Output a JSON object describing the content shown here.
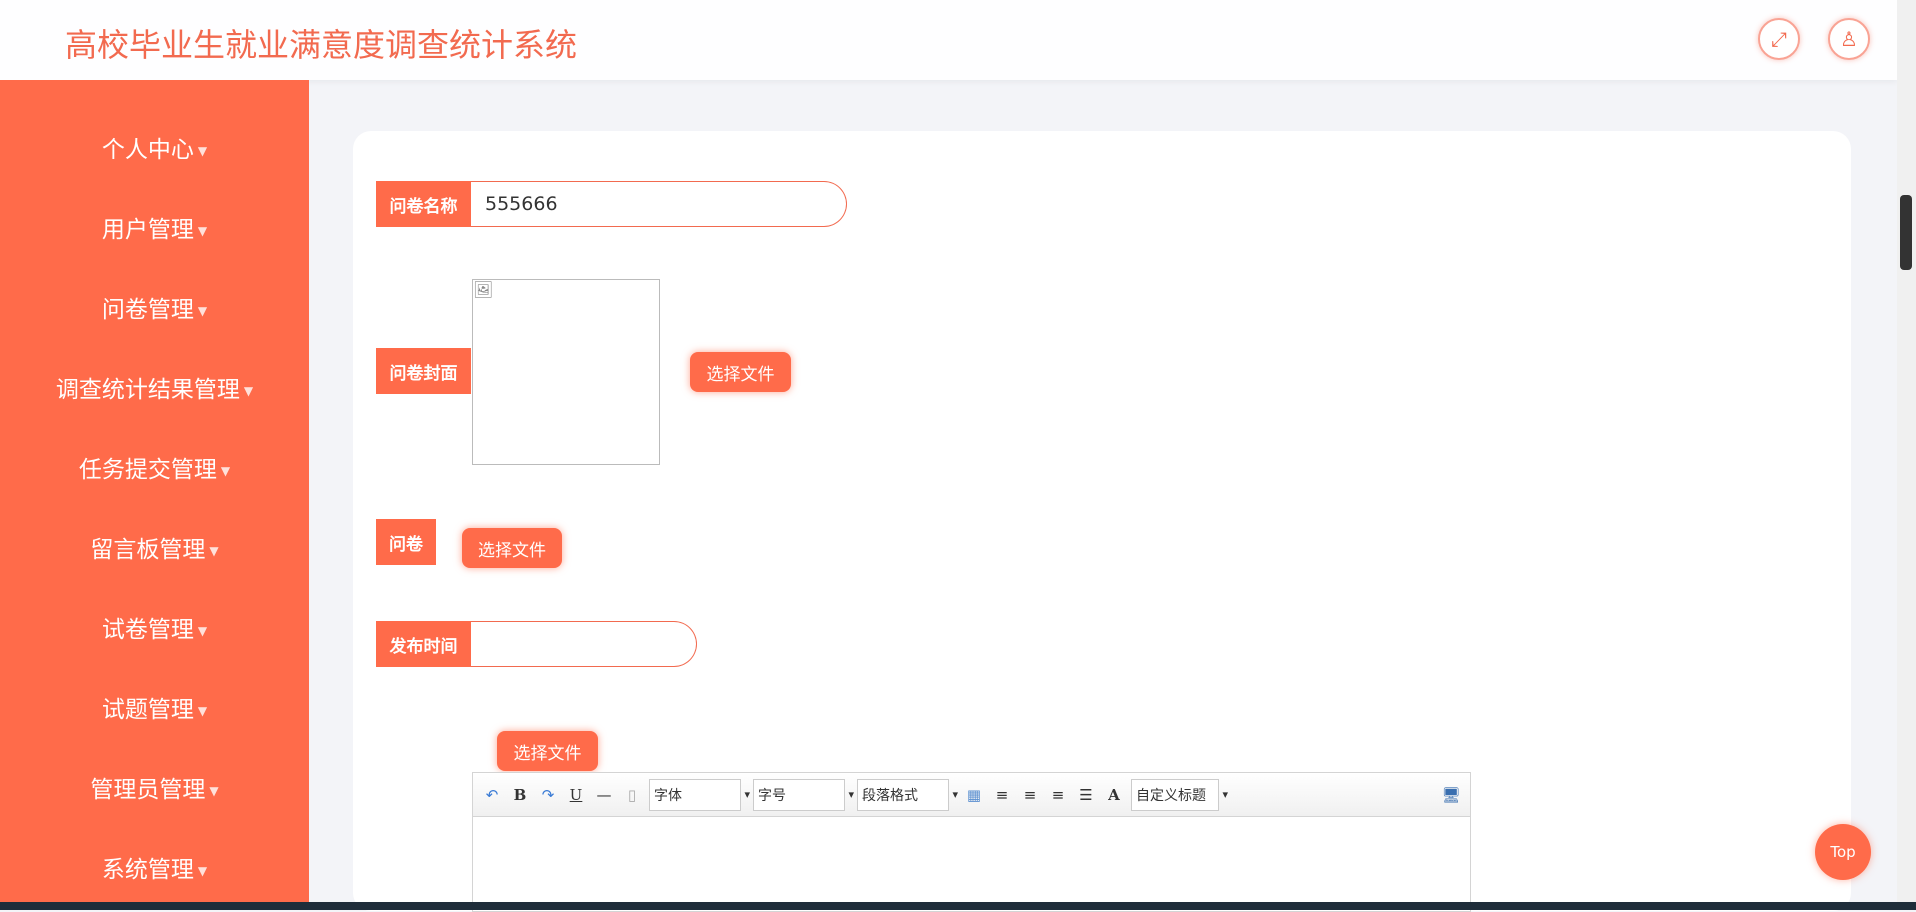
{
  "header": {
    "title": "高校毕业生就业满意度调查统计系统",
    "fullscreen_icon": "expand-icon",
    "user_icon": "user-icon"
  },
  "sidebar": {
    "items": [
      {
        "label": "个人中心"
      },
      {
        "label": "用户管理"
      },
      {
        "label": "问卷管理"
      },
      {
        "label": "调查统计结果管理"
      },
      {
        "label": "任务提交管理"
      },
      {
        "label": "留言板管理"
      },
      {
        "label": "试卷管理"
      },
      {
        "label": "试题管理"
      },
      {
        "label": "管理员管理"
      },
      {
        "label": "系统管理"
      }
    ]
  },
  "form": {
    "name_label": "问卷名称",
    "name_value": "555666",
    "cover_label": "问卷封面",
    "cover_button": "选择文件",
    "file_label": "问卷",
    "file_button": "选择文件",
    "time_label": "发布时间",
    "time_value": "",
    "content_button": "选择文件"
  },
  "editor": {
    "font": "字体",
    "size": "字号",
    "paragraph": "段落格式",
    "custom_title": "自定义标题",
    "bold": "B",
    "underline": "U",
    "font_color": "A"
  },
  "top_button": "Top"
}
